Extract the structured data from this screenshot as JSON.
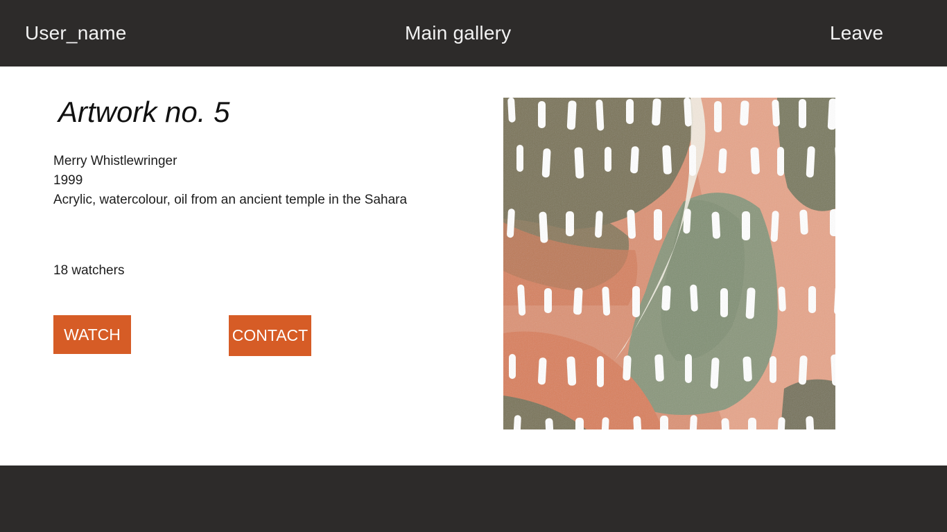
{
  "header": {
    "user_label": "User_name",
    "gallery_label": "Main gallery",
    "leave_label": "Leave"
  },
  "artwork": {
    "title": "Artwork no. 5",
    "artist": "Merry Whistlewringer",
    "year": "1999",
    "medium": "Acrylic, watercolour, oil from an ancient temple in the Sahara",
    "watchers": "18 watchers"
  },
  "actions": {
    "watch_label": "WATCH",
    "contact_label": "CONTACT"
  },
  "colors": {
    "bar": "#2d2b2a",
    "accent": "#d65c26",
    "olive": "#7b7458",
    "terracotta": "#d9805c",
    "sage": "#7f8e72"
  }
}
